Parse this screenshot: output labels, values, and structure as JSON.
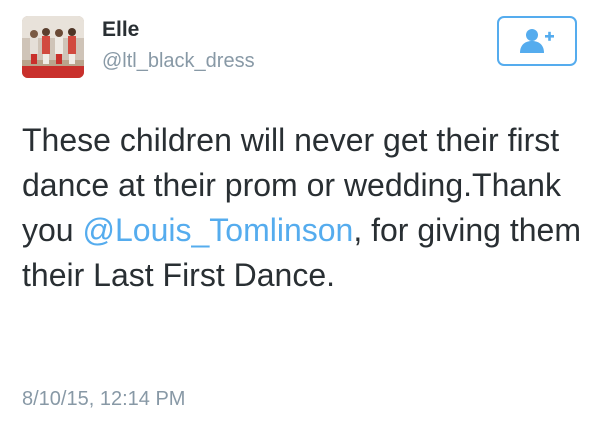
{
  "user": {
    "name": "Elle",
    "handle": "@ltl_black_dress"
  },
  "follow_button": {
    "icon": "add-user-icon",
    "color": "#55acee"
  },
  "tweet": {
    "text_part1": "These children will never get their first dance at their prom or wedding.Thank you ",
    "mention": "@Louis_Tomlinson",
    "text_part2": ", for giving them their Last First Dance."
  },
  "timestamp": "8/10/15, 12:14 PM",
  "colors": {
    "text": "#292f33",
    "muted": "#8899a6",
    "accent": "#55acee"
  }
}
